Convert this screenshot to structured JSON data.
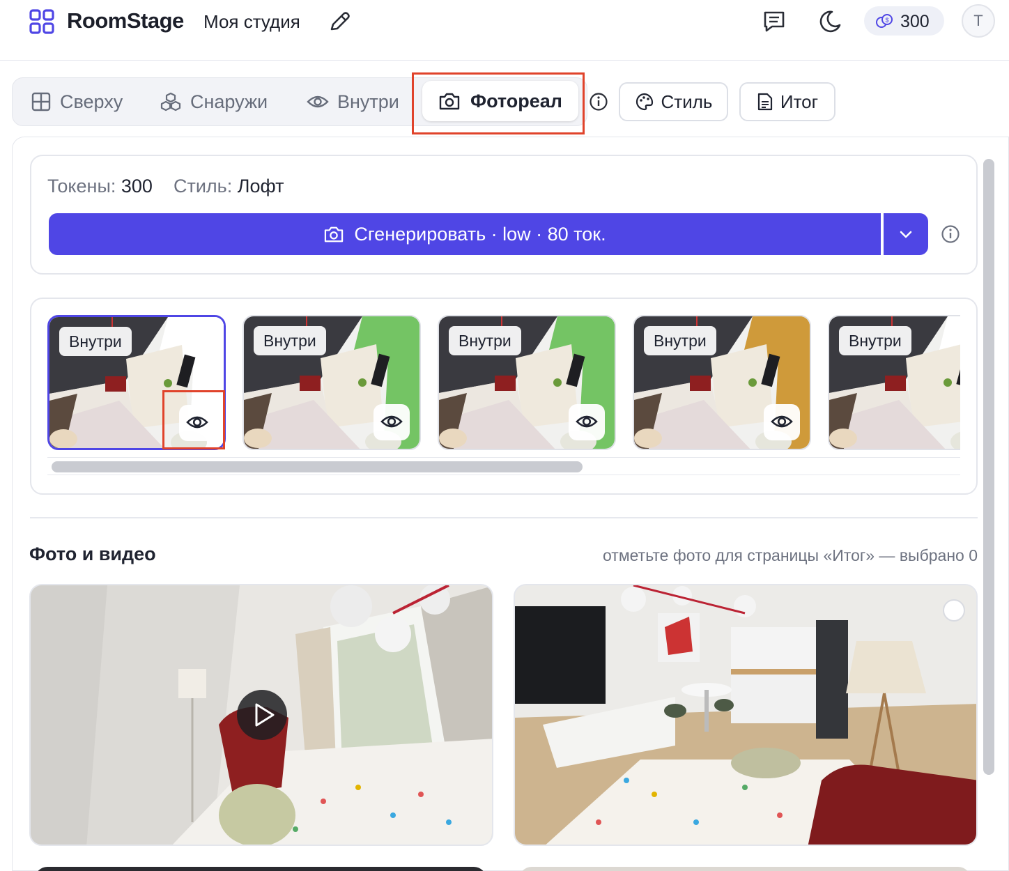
{
  "header": {
    "brand": "RoomStage",
    "project_name": "Моя студия",
    "balance": "300",
    "avatar_initial": "T"
  },
  "tabs": {
    "items": [
      {
        "label": "Сверху",
        "icon": "grid-icon"
      },
      {
        "label": "Снаружи",
        "icon": "boxes-icon"
      },
      {
        "label": "Внутри",
        "icon": "eye-icon"
      }
    ],
    "active_label": "Фотореал",
    "style_label": "Стиль",
    "summary_label": "Итог"
  },
  "generate": {
    "tokens_label": "Токены:",
    "tokens_value": "300",
    "style_label": "Стиль:",
    "style_value": "Лофт",
    "button_label": "Сгенерировать · low · 80 ток."
  },
  "thumbnails": [
    {
      "label": "Внутри",
      "accent": "#ffffff",
      "selected": true
    },
    {
      "label": "Внутри",
      "accent": "#74c464",
      "selected": false
    },
    {
      "label": "Внутри",
      "accent": "#74c464",
      "selected": false
    },
    {
      "label": "Внутри",
      "accent": "#cf9a3a",
      "selected": false
    },
    {
      "label": "Внутри",
      "accent": "#ffffff",
      "selected": false
    }
  ],
  "media": {
    "title": "Фото и видео",
    "hint": "отметьте фото для страницы «Итог» — выбрано 0"
  },
  "colors": {
    "primary": "#4f46e5",
    "highlight": "#e0432b"
  }
}
